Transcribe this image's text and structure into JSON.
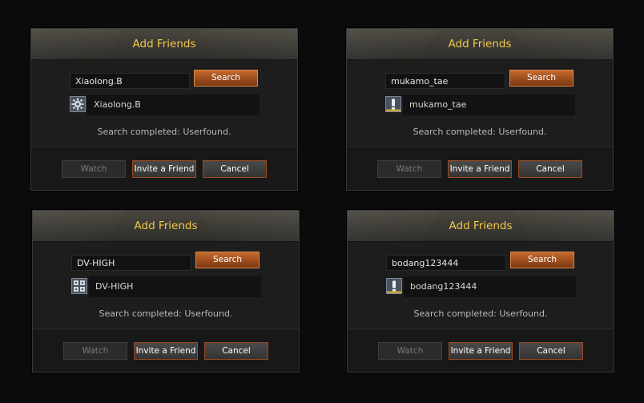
{
  "dialogs": [
    {
      "title": "Add Friends",
      "search_value": "Xiaolong.B",
      "search_button_label": "Search",
      "result_icon": "gear-icon",
      "result_name": "Xiaolong.B",
      "status_text": "Search completed: Userfound.",
      "watch_label": "Watch",
      "invite_label": "Invite a Friend",
      "cancel_label": "Cancel"
    },
    {
      "title": "Add Friends",
      "search_value": "mukamo_tae",
      "search_button_label": "Search",
      "result_icon": "alert-icon",
      "result_name": "mukamo_tae",
      "status_text": "Search completed: Userfound.",
      "watch_label": "Watch",
      "invite_label": "Invite a Friend",
      "cancel_label": "Cancel"
    },
    {
      "title": "Add Friends",
      "search_value": "DV-HIGH",
      "search_button_label": "Search",
      "result_icon": "grid-icon",
      "result_name": "DV-HIGH",
      "status_text": "Search completed: Userfound.",
      "watch_label": "Watch",
      "invite_label": "Invite a Friend",
      "cancel_label": "Cancel"
    },
    {
      "title": "Add Friends",
      "search_value": "bodang123444",
      "search_button_label": "Search",
      "result_icon": "alert-icon",
      "result_name": "bodang123444",
      "status_text": "Search completed: Userfound.",
      "watch_label": "Watch",
      "invite_label": "Invite a Friend",
      "cancel_label": "Cancel"
    }
  ],
  "colors": {
    "title": "#f2c94a",
    "accent": "#b35a24",
    "panel": "#1d1d1d",
    "background": "#0b0b0b"
  }
}
